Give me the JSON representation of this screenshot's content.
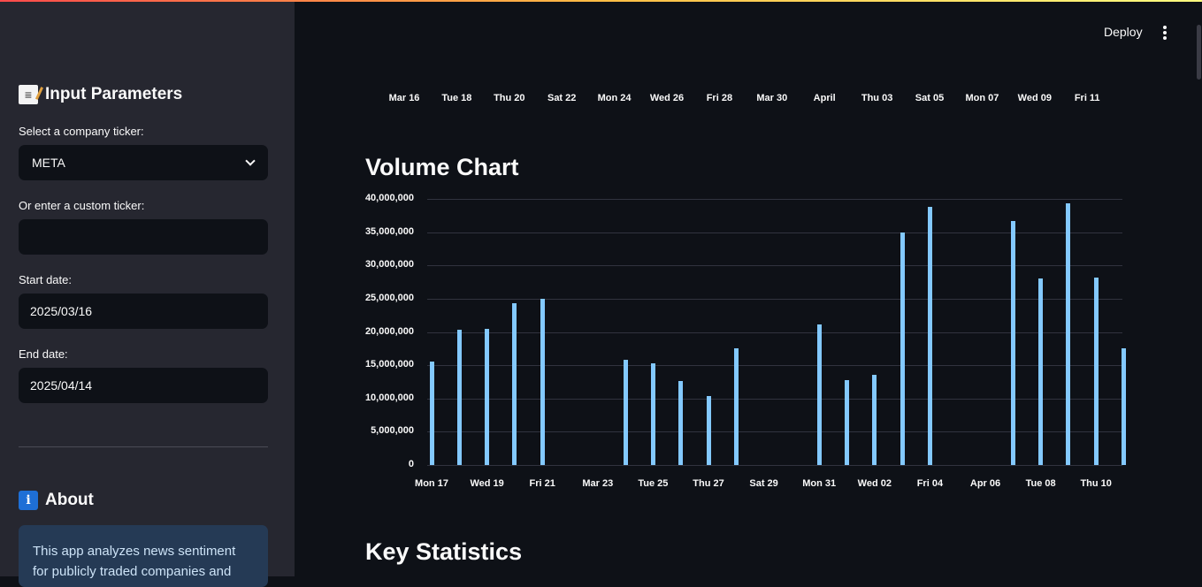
{
  "sidebar": {
    "input_heading": "Input Parameters",
    "input_icon": "memo-icon",
    "ticker_label": "Select a company ticker:",
    "ticker_value": "META",
    "custom_label": "Or enter a custom ticker:",
    "custom_value": "",
    "start_label": "Start date:",
    "start_value": "2025/03/16",
    "end_label": "End date:",
    "end_value": "2025/04/14",
    "about_heading": "About",
    "about_icon": "info-icon",
    "about_text": "This app analyzes news sentiment for publicly traded companies and"
  },
  "header": {
    "deploy_label": "Deploy"
  },
  "price_chart_axis": {
    "x_ticks": [
      "Mar 16",
      "Tue 18",
      "Thu 20",
      "Sat 22",
      "Mon 24",
      "Wed 26",
      "Fri 28",
      "Mar 30",
      "April",
      "Thu 03",
      "Sat 05",
      "Mon 07",
      "Wed 09",
      "Fri 11"
    ]
  },
  "volume_section": {
    "title": "Volume Chart"
  },
  "stats_section": {
    "title": "Key Statistics"
  },
  "colors": {
    "bar": "#83c9ff",
    "sidebar_bg": "#262730",
    "main_bg": "#0e1117"
  },
  "chart_data": {
    "type": "bar",
    "title": "",
    "xlabel": "",
    "ylabel": "",
    "ylim": [
      0,
      40000000
    ],
    "y_ticks": [
      "40,000,000",
      "35,000,000",
      "30,000,000",
      "25,000,000",
      "20,000,000",
      "15,000,000",
      "10,000,000",
      "5,000,000",
      "0"
    ],
    "x_ticks": [
      "Mon 17",
      "Wed 19",
      "Fri 21",
      "Mar 23",
      "Tue 25",
      "Thu 27",
      "Sat 29",
      "Mon 31",
      "Wed 02",
      "Fri 04",
      "Apr 06",
      "Tue 08",
      "Thu 10"
    ],
    "x_range": [
      "2025-03-17",
      "2025-04-11"
    ],
    "categories": [
      "2025-03-17",
      "2025-03-18",
      "2025-03-19",
      "2025-03-20",
      "2025-03-21",
      "2025-03-24",
      "2025-03-25",
      "2025-03-26",
      "2025-03-27",
      "2025-03-28",
      "2025-03-31",
      "2025-04-01",
      "2025-04-02",
      "2025-04-03",
      "2025-04-04",
      "2025-04-07",
      "2025-04-08",
      "2025-04-09",
      "2025-04-10",
      "2025-04-11"
    ],
    "values": [
      15500000,
      20300000,
      20500000,
      24300000,
      25000000,
      15800000,
      15300000,
      12600000,
      10400000,
      17600000,
      21100000,
      12800000,
      13500000,
      34900000,
      38800000,
      36700000,
      28000000,
      39400000,
      28200000,
      17600000
    ]
  }
}
